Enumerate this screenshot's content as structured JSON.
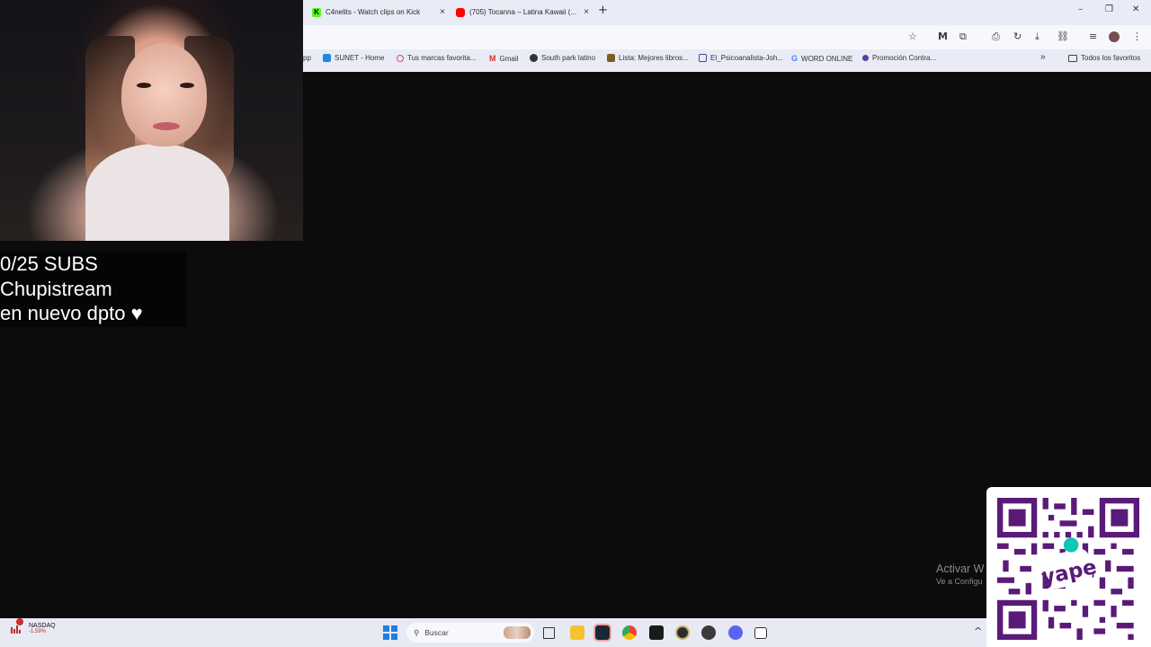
{
  "overlay": {
    "subs_line": "0/25 SUBS",
    "title_line": "Chupistream",
    "subtitle_line": "en nuevo dpto ♥"
  },
  "browser": {
    "tabs": [
      {
        "label": "C4nelits - Watch clips on Kick",
        "icon": "kick-icon"
      },
      {
        "label": "(705) Tocanna – Latina Kawaii (...",
        "icon": "youtube-icon"
      }
    ],
    "new_tab": "+",
    "window_controls": {
      "minimize": "–",
      "restore": "❐",
      "close": "✕"
    },
    "bookmarks": [
      {
        "label": "pp",
        "color": "#8a8a8a"
      },
      {
        "label": "SUNET - Home",
        "color": "#1e88e5"
      },
      {
        "label": "Tus marcas favorita...",
        "color": "#e0457b"
      },
      {
        "label": "Gmail",
        "color": "#d93025"
      },
      {
        "label": "South park latino",
        "color": "#333333"
      },
      {
        "label": "Lista: Mejores libros...",
        "color": "#7b5d2a"
      },
      {
        "label": "El_Psicoanalista-Joh...",
        "color": "#4a4a8a"
      },
      {
        "label": "WORD ONLINE",
        "color": "#4285f4"
      },
      {
        "label": "Promoción Contra...",
        "color": "#5b3fa5"
      }
    ],
    "bookmarks_overflow": "»",
    "all_bookmarks": "Todos los favoritos"
  },
  "watermark": {
    "line1": "Activar W",
    "line2": "Ve a Configu"
  },
  "qr": {
    "brand": "yape"
  },
  "taskbar": {
    "stock": {
      "name": "NASDAQ",
      "change": "-1.59%"
    },
    "search_placeholder": "Buscar"
  }
}
